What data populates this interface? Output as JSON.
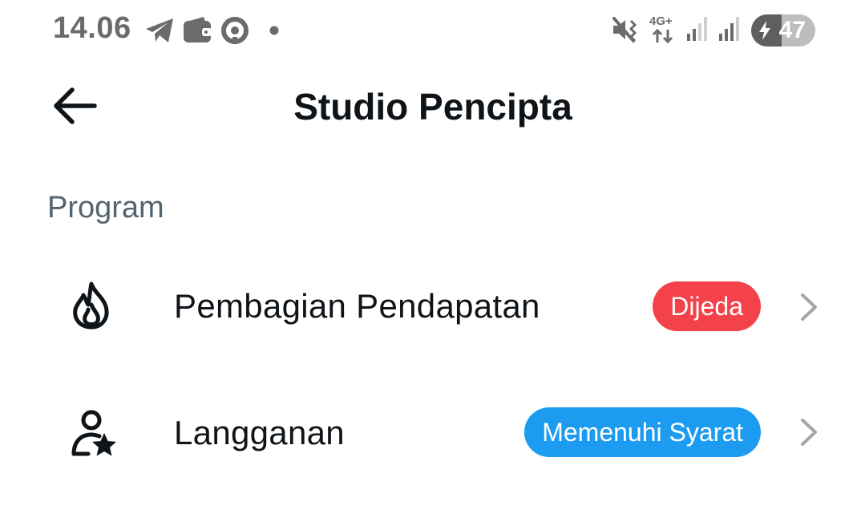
{
  "status_bar": {
    "time": "14.06",
    "battery_percent": "47",
    "battery_level": 0.47,
    "left_icons": [
      "telegram-icon",
      "wallet-icon",
      "circle-app-icon",
      "notification-dot-icon"
    ],
    "right_icons": [
      "vibrate-icon",
      "network-4g-icon",
      "signal-1-icon",
      "signal-2-icon",
      "battery-charging-icon"
    ],
    "network_label": "4G+"
  },
  "header": {
    "title": "Studio Pencipta",
    "back_icon": "arrow-left-icon"
  },
  "section": {
    "title": "Program"
  },
  "items": [
    {
      "label": "Pembagian Pendapatan",
      "icon": "flame-icon",
      "badge": "Dijeda",
      "badge_color": "#f4424a"
    },
    {
      "label": "Langganan",
      "icon": "person-star-icon",
      "badge": "Memenuhi Syarat",
      "badge_color": "#1d9bf0"
    }
  ],
  "colors": {
    "text_primary": "#0f1419",
    "text_secondary": "#536471",
    "chevron": "#a0a7ad",
    "status_grey": "#6b6b6b"
  }
}
